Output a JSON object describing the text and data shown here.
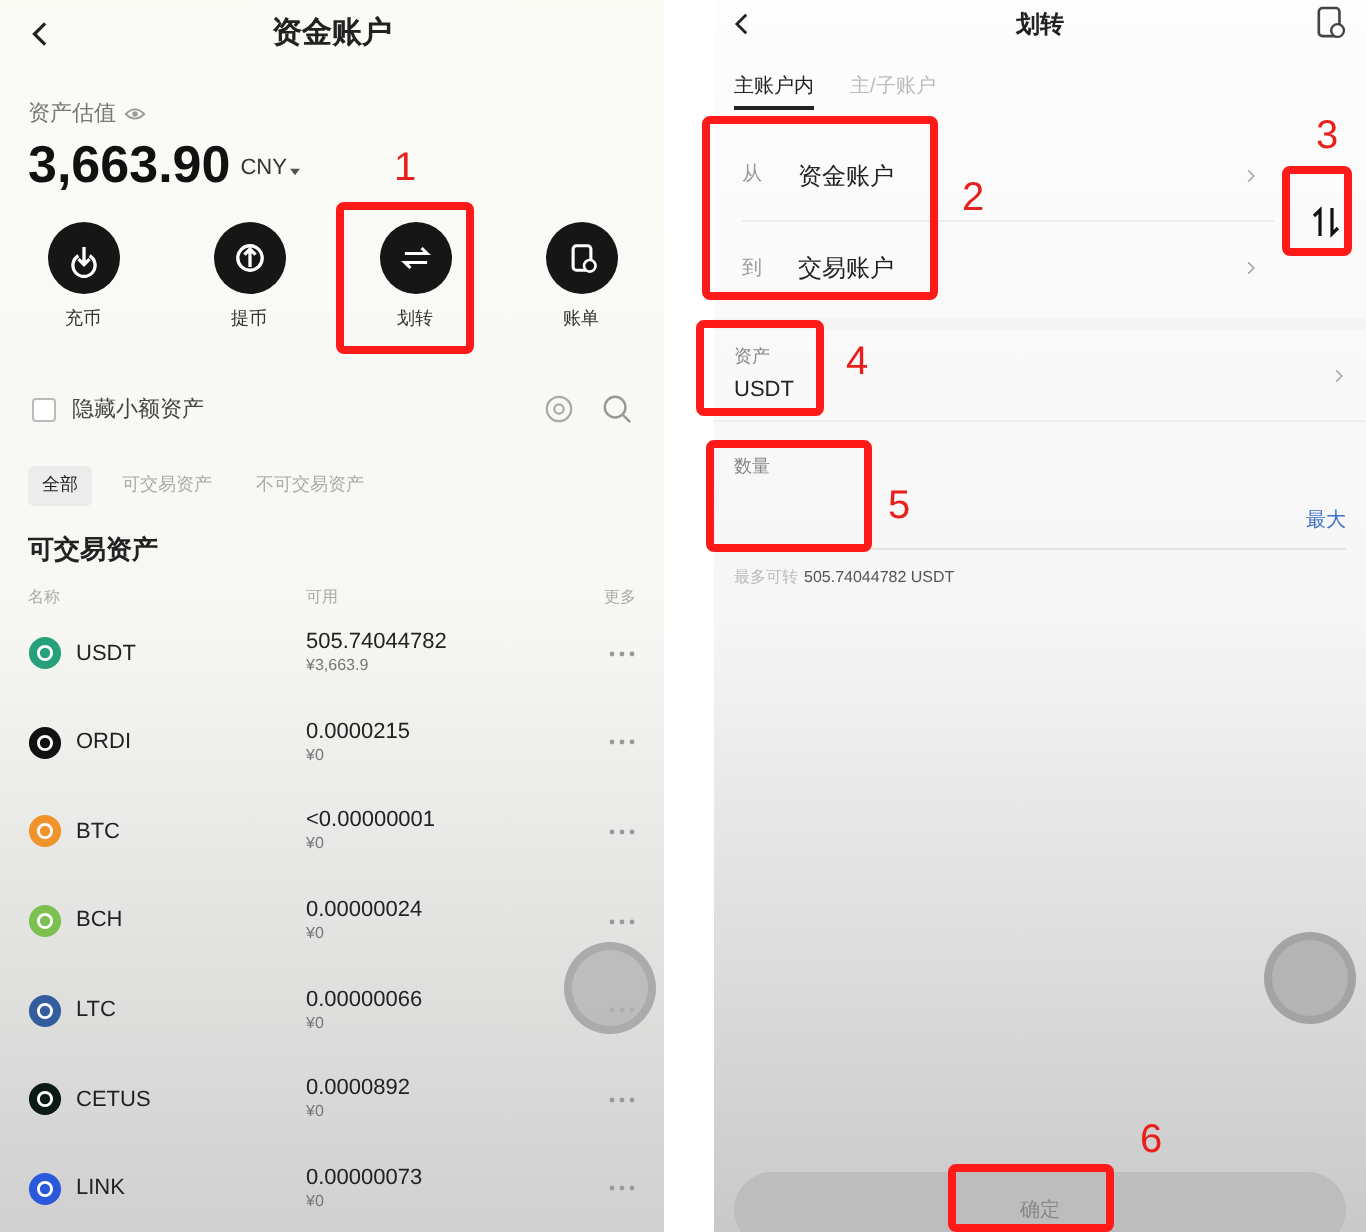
{
  "funding_screen": {
    "title": "资金账户",
    "valuation_label": "资产估值",
    "total": "3,663.90",
    "currency": "CNY",
    "actions": [
      {
        "label": "充币",
        "kind": "deposit"
      },
      {
        "label": "提币",
        "kind": "withdraw"
      },
      {
        "label": "划转",
        "kind": "transfer"
      },
      {
        "label": "账单",
        "kind": "bill"
      }
    ],
    "hide_small": {
      "label": "隐藏小额资产",
      "checked": false
    },
    "filters": [
      {
        "label": "全部",
        "selected": true
      },
      {
        "label": "可交易资产",
        "selected": false
      },
      {
        "label": "不可交易资产",
        "selected": false
      }
    ],
    "section_title": "可交易资产",
    "columns": [
      "名称",
      "可用",
      "更多"
    ],
    "assets": [
      {
        "name": "USDT",
        "color": "#26a17b",
        "amount": "505.74044782",
        "value": "¥3,663.9"
      },
      {
        "name": "ORDI",
        "color": "#111111",
        "amount": "0.0000215",
        "value": "¥0"
      },
      {
        "name": "BTC",
        "color": "#f0932b",
        "amount": "<0.00000001",
        "value": "¥0"
      },
      {
        "name": "BCH",
        "color": "#7cc04f",
        "amount": "0.00000024",
        "value": "¥0"
      },
      {
        "name": "LTC",
        "color": "#345d9d",
        "amount": "0.00000066",
        "value": "¥0"
      },
      {
        "name": "CETUS",
        "color": "#0b1a14",
        "amount": "0.0000892",
        "value": "¥0"
      },
      {
        "name": "LINK",
        "color": "#2a5ada",
        "amount": "0.00000073",
        "value": "¥0"
      }
    ]
  },
  "transfer_screen": {
    "title": "划转",
    "tabs": [
      {
        "label": "主账户内",
        "selected": true
      },
      {
        "label": "主/子账户",
        "selected": false
      }
    ],
    "from": {
      "label": "从",
      "account": "资金账户"
    },
    "to": {
      "label": "到",
      "account": "交易账户"
    },
    "asset": {
      "label": "资产",
      "value": "USDT"
    },
    "amount": {
      "label": "数量",
      "max_button": "最大",
      "limit_label": "最多可转",
      "limit_value": "505.74044782 USDT"
    },
    "confirm": {
      "label": "确定",
      "disabled": true
    }
  },
  "callouts": [
    {
      "label": "1"
    },
    {
      "label": "2"
    },
    {
      "label": "3"
    },
    {
      "label": "4"
    },
    {
      "label": "5"
    },
    {
      "label": "6"
    }
  ]
}
